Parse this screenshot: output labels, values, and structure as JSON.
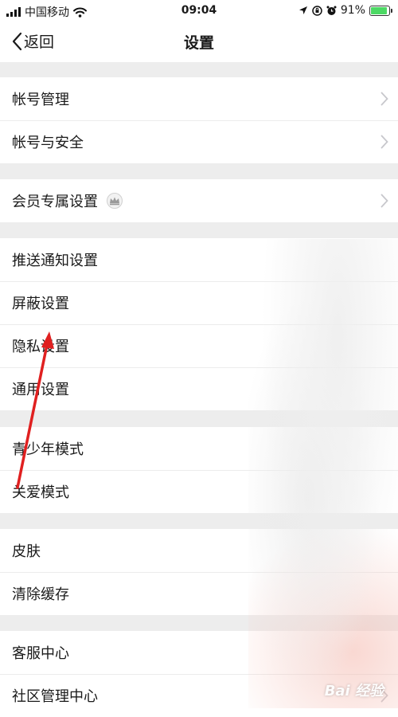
{
  "status_bar": {
    "carrier": "中国移动",
    "time": "09:04",
    "battery": "91%",
    "battery_level": 0.91
  },
  "nav": {
    "back_label": "返回",
    "title": "设置"
  },
  "groups": [
    {
      "items": [
        {
          "label": "帐号管理"
        },
        {
          "label": "帐号与安全"
        }
      ]
    },
    {
      "items": [
        {
          "label": "会员专属设置"
        }
      ]
    },
    {
      "items": [
        {
          "label": "推送通知设置"
        },
        {
          "label": "屏蔽设置"
        },
        {
          "label": "隐私设置"
        },
        {
          "label": "通用设置"
        }
      ]
    },
    {
      "items": [
        {
          "label": "青少年模式"
        },
        {
          "label": "关爱模式"
        }
      ]
    },
    {
      "items": [
        {
          "label": "皮肤"
        },
        {
          "label": "清除缓存"
        }
      ]
    },
    {
      "items": [
        {
          "label": "客服中心"
        },
        {
          "label": "社区管理中心"
        }
      ]
    }
  ],
  "watermark": "Bai 经验",
  "colors": {
    "background": "#ededed",
    "row_background": "#ffffff",
    "chevron": "#c7c7cc",
    "annotation_arrow": "#e02020",
    "battery_fill": "#4cd964"
  }
}
